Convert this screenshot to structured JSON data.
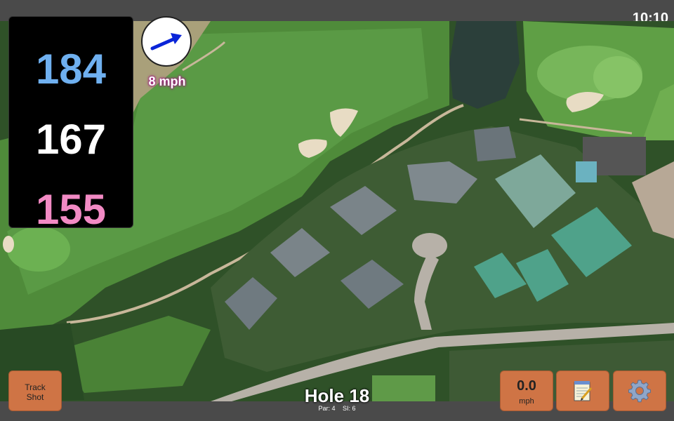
{
  "status": {
    "time": "10:10"
  },
  "distances": {
    "back": "184",
    "center": "167",
    "front": "155"
  },
  "wind": {
    "speed_label": "8 mph",
    "direction_icon": "arrow-icon"
  },
  "buttons": {
    "track_shot": "Track Shot",
    "wind_speed_value": "0.0",
    "wind_speed_unit": "mph",
    "notes_icon": "notepad-icon",
    "settings_icon": "gear-icon"
  },
  "hole": {
    "title": "Hole 18",
    "par": "Par: 4",
    "si": "SI: 6"
  },
  "colors": {
    "back": "#6fb0f0",
    "center": "#ffffff",
    "front": "#f28ac4",
    "button": "#cf7445"
  }
}
